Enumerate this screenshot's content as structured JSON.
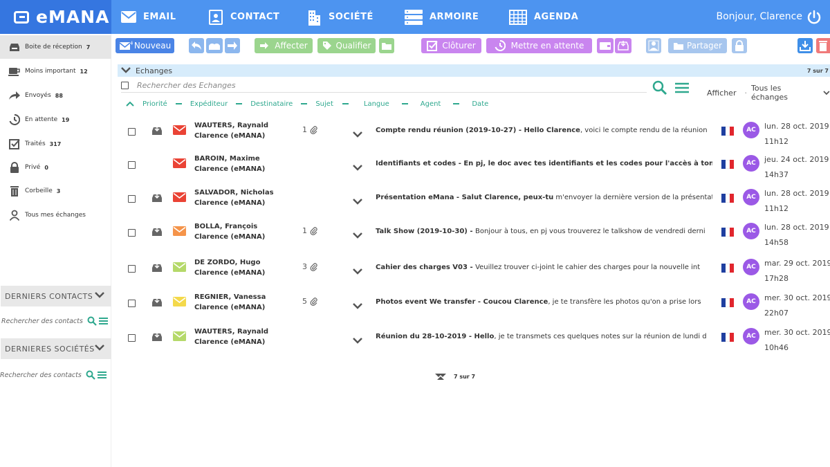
{
  "app": {
    "logo_text": "eMANA",
    "greeting": "Bonjour, Clarence"
  },
  "nav": [
    {
      "label": "EMAIL",
      "icon": "envelope-icon"
    },
    {
      "label": "CONTACT",
      "icon": "contact-card-icon"
    },
    {
      "label": "SOCIÉTÉ",
      "icon": "building-icon"
    },
    {
      "label": "ARMOIRE",
      "icon": "cabinet-icon"
    },
    {
      "label": "AGENDA",
      "icon": "calendar-icon"
    }
  ],
  "sidebar": {
    "items": [
      {
        "label": "Boite de réception",
        "count": "7",
        "icon": "inbox-icon"
      },
      {
        "label": "Moins important",
        "count": "12",
        "icon": "coffee-icon"
      },
      {
        "label": "Envoyés",
        "count": "88",
        "icon": "share-arrow-icon"
      },
      {
        "label": "En attente",
        "count": "19",
        "icon": "clock-icon"
      },
      {
        "label": "Traités",
        "count": "317",
        "icon": "checkbox-icon"
      },
      {
        "label": "Privé",
        "count": "0",
        "icon": "lock-icon"
      },
      {
        "label": "Corbeille",
        "count": "3",
        "icon": "trash-icon"
      },
      {
        "label": "Tous mes échanges",
        "count": "",
        "icon": "person-icon"
      }
    ],
    "contacts_title": "DERNIERS CONTACTS",
    "contacts_search_placeholder": "Rechercher des contacts",
    "companies_title": "DERNIERES SOCIÉTÉS",
    "companies_search_placeholder": "Rechercher des contacts"
  },
  "toolbar": {
    "new_label": "Nouveau",
    "assign_label": "Affecter",
    "qualify_label": "Qualifier",
    "close_label": "Clôturer",
    "hold_label": "Mettre en attente",
    "share_label": "Partager"
  },
  "list": {
    "title": "Echanges",
    "count": "7 sur 7",
    "search_placeholder": "Rechercher des Echanges",
    "show_label": "Afficher",
    "filter_value": "Tous les échanges",
    "sort_columns": [
      "Priorité",
      "Expéditeur",
      "Destinataire",
      "Sujet",
      "Langue",
      "Agent",
      "Date"
    ]
  },
  "rows": [
    {
      "sender": "WAUTERS, Raynald",
      "recipient": "Clarence (eMANA)",
      "attachments": "1",
      "tray": true,
      "env_color": "#ea4335",
      "subject": "Compte rendu réunion (2019-10-27)",
      "preview_bold": "Hello Clarence",
      "preview": ", voici le compte rendu de la réunion",
      "agent": "AC",
      "date": "lun. 28 oct. 2019",
      "time": "11h12"
    },
    {
      "sender": "BAROIN, Maxime",
      "recipient": "Clarence (eMANA)",
      "attachments": "",
      "tray": false,
      "env_color": "#ea4335",
      "subject": "Identifiants et codes",
      "preview_bold": "En pj, le doc avec tes identifiants et les codes pour l'accès à ton",
      "preview": "",
      "agent": "AC",
      "date": "jeu. 24 oct. 2019",
      "time": "14h37"
    },
    {
      "sender": "SALVADOR, Nicholas",
      "recipient": "Clarence (eMANA)",
      "attachments": "",
      "tray": true,
      "env_color": "#ea4335",
      "subject": "Présentation eMana",
      "preview_bold": "Salut Clarence, peux-tu",
      "preview": " m'envoyer la dernière version de la présentat",
      "agent": "AC",
      "date": "lun. 28 oct. 2019",
      "time": "11h12"
    },
    {
      "sender": "BOLLA, François",
      "recipient": "Clarence (eMANA)",
      "attachments": "1",
      "tray": true,
      "env_color": "#f5944a",
      "subject": "Talk Show (2019-10-30)",
      "preview_bold": "",
      "preview": "Bonjour à tous, en pj vous trouverez le talkshow de vendredi derni",
      "agent": "AC",
      "date": "lun. 28 oct. 2019",
      "time": "14h58"
    },
    {
      "sender": "DE ZORDO, Hugo",
      "recipient": "Clarence (eMANA)",
      "attachments": "3",
      "tray": true,
      "env_color": "#b5d96a",
      "subject": "Cahier des charges V03",
      "preview_bold": "",
      "preview": "Veuillez trouver ci-joint le cahier des charges pour la nouvelle int",
      "agent": "AC",
      "date": "mar. 29 oct. 2019",
      "time": "17h28"
    },
    {
      "sender": "REGNIER, Vanessa",
      "recipient": "Clarence (eMANA)",
      "attachments": "5",
      "tray": true,
      "env_color": "#f4d94b",
      "subject": "Photos event We transfer",
      "preview_bold": "Coucou Clarence",
      "preview": ", je te transfère les photos qu'on a prise lors",
      "agent": "AC",
      "date": "mer. 30 oct. 2019",
      "time": "22h07"
    },
    {
      "sender": "WAUTERS, Raynald",
      "recipient": "Clarence (eMANA)",
      "attachments": "",
      "tray": true,
      "env_color": "#b5d96a",
      "subject": "Réunion du 28-10-2019",
      "preview_bold": "Hello",
      "preview": ", je te transmets ces quelques notes sur la réunion de lundi d",
      "agent": "AC",
      "date": "mer. 30 oct. 2019",
      "time": "10h46"
    }
  ],
  "pager": {
    "label": "7 sur 7"
  },
  "colors": {
    "topbar": "#4d94f0",
    "logo_bg": "#3576e0",
    "accent_green": "#2ea88e",
    "avatar": "#9b59e6"
  }
}
